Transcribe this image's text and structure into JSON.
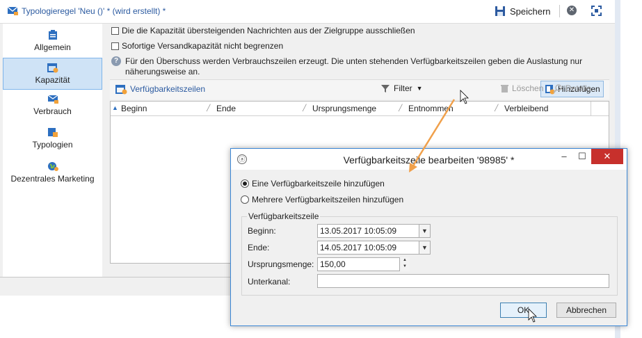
{
  "window": {
    "title": "Typologieregel 'Neu ()' * (wird erstellt) *",
    "save_label": "Speichern"
  },
  "sidebar": {
    "items": [
      {
        "label": "Allgemein"
      },
      {
        "label": "Kapazität"
      },
      {
        "label": "Verbrauch"
      },
      {
        "label": "Typologien"
      },
      {
        "label": "Dezentrales Marketing"
      }
    ]
  },
  "options": {
    "exclude_label": "Die die Kapazität übersteigenden Nachrichten aus der Zielgruppe ausschließen",
    "nolimit_label": "Sofortige Versandkapazität nicht begrenzen",
    "info_text": "Für den Überschuss werden Verbrauchszeilen erzeugt. Die unten stehenden Verfügbarkeitszeilen geben die Auslastung nur näherungsweise an."
  },
  "grid_toolbar": {
    "title": "Verfügbarkeitszeilen",
    "filter_label": "Filter",
    "add_label": "Hinzufügen",
    "delete_label": "Löschen",
    "details_label": "Details..."
  },
  "grid": {
    "columns": [
      "Beginn",
      "Ende",
      "Ursprungsmenge",
      "Entnommen",
      "Verbleibend"
    ]
  },
  "dialog": {
    "title": "Verfügbarkeitszeile bearbeiten '98985' *",
    "radio_single": "Eine Verfügbarkeitszeile hinzufügen",
    "radio_multi": "Mehrere Verfügbarkeitszeilen hinzufügen",
    "group_label": "Verfügbarkeitszeile",
    "start_label": "Beginn:",
    "start_value": "13.05.2017 10:05:09",
    "end_label": "Ende:",
    "end_value": "14.05.2017 10:05:09",
    "quantity_label": "Ursprungsmenge:",
    "quantity_value": "150,00",
    "subchannel_label": "Unterkanal:",
    "subchannel_value": "",
    "ok_label": "OK",
    "cancel_label": "Abbrechen"
  },
  "colors": {
    "accent": "#2b5aa0",
    "highlight": "#cfe3f6",
    "annotation_arrow": "#f0a04b",
    "close_red": "#c7302c"
  }
}
